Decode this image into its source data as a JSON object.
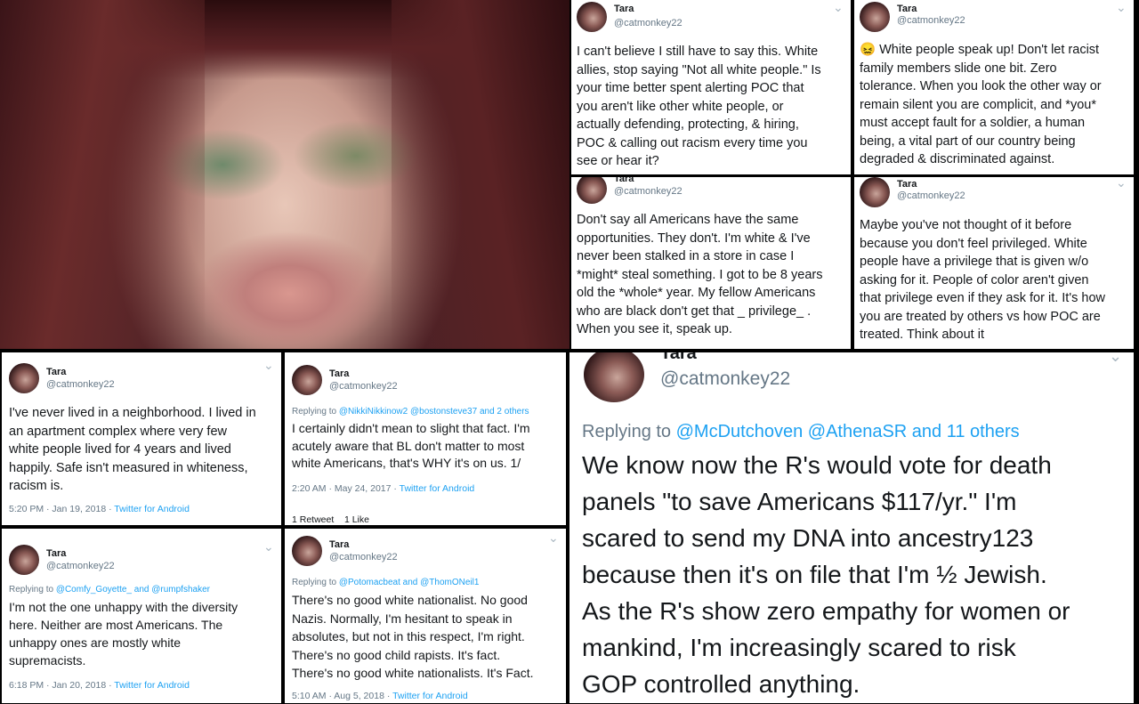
{
  "photo": {
    "alt": "profile photo"
  },
  "tweets": [
    {
      "name": "Tara",
      "handle": "@catmonkey22",
      "text": "I can't believe I still have to say this.  White\nallies, stop saying \"Not all white people.\" Is\nyour time better spent alerting POC that\nyou aren't  like other white people, or\nactually defending, protecting, & hiring,\nPOC & calling out racism every time you\nsee or hear it?"
    },
    {
      "name": "Tara",
      "handle": "@catmonkey22",
      "emoji": "😖",
      "text": "White people speak up! Don't let racist\nfamily members slide one bit. Zero\ntolerance. When you look the other way or\nremain silent you are complicit, and *you*\nmust accept fault for a soldier, a human\nbeing, a vital part of our country being\ndegraded & discriminated against."
    },
    {
      "name": "Tara",
      "handle": "@catmonkey22",
      "text": "Don't say all Americans have the same\nopportunities. They don't.  I'm white & I've\nnever been stalked in a store in case I\n*might* steal something. I got to be 8 years\nold the *whole* year. My fellow Americans\nwho are black don't get that _ privilege_ .\nWhen you see it, speak up."
    },
    {
      "name": "Tara",
      "handle": "@catmonkey22",
      "text": "Maybe you've not thought of it before\nbecause you don't feel privileged. White\npeople have a privilege that is given w/o\nasking for it. People of color aren't given\nthat privilege even if they ask for it.  It's how\nyou are treated by others vs how POC are\ntreated.  Think about it"
    },
    {
      "name": "Tara",
      "handle": "@catmonkey22",
      "text": "I've never lived in a neighborhood.  I lived in\nan apartment complex where very few\nwhite people lived for 4 years and lived\nhappily.  Safe isn't measured in whiteness,\nracism is.",
      "time": "5:20 PM · Jan 19, 2018 · ",
      "source": "Twitter for Android"
    },
    {
      "name": "Tara",
      "handle": "@catmonkey22",
      "reply_prefix": "Replying to ",
      "reply_to": "@NikkiNikkinow2 @bostonsteve37 and 2 others",
      "text": "I certainly didn't mean to slight that fact.  I'm\nacutely aware that BL don't matter to most\nwhite Americans, that's WHY it's on us. 1/",
      "time": "2:20 AM · May 24, 2017 · ",
      "source": "Twitter for Android",
      "stats": "1 Retweet    1 Like"
    },
    {
      "name": "Tara",
      "handle": "@catmonkey22",
      "reply_prefix": "Replying to ",
      "reply_to": "@Comfy_Goyette_ and @rumpfshaker",
      "text": "I'm not the one unhappy with the diversity\nhere.  Neither are most Americans.  The\nunhappy ones are mostly white\nsupremacists.",
      "time": "6:18 PM · Jan 20, 2018 · ",
      "source": "Twitter for Android"
    },
    {
      "name": "Tara",
      "handle": "@catmonkey22",
      "reply_prefix": "Replying to ",
      "reply_to": "@Potomacbeat and @ThomONeil1",
      "text": "There's no good white nationalist.  No good\nNazis.  Normally, I'm hesitant to speak in\nabsolutes, but not in this respect, I'm right.\nThere's no good child rapists. It's fact.\nThere's no good white nationalists. It's Fact.",
      "time": "5:10 AM · Aug 5, 2018 · ",
      "source": "Twitter for Android"
    },
    {
      "name": "Tara",
      "handle": "@catmonkey22",
      "reply_prefix": "Replying to ",
      "reply_to": "@McDutchoven @AthenaSR and 11 others",
      "text": "We know now the R's would vote for death\npanels \"to save Americans $117/yr.\" I'm\nscared to send my DNA into ancestry123\nbecause then it's on file that I'm ½ Jewish.\nAs the R's show zero empathy for women or\nmankind, I'm increasingly scared to risk\nGOP controlled anything."
    }
  ],
  "icons": {
    "chevron": "⌄"
  }
}
